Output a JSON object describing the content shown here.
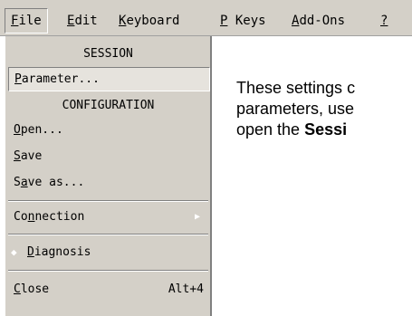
{
  "menubar": {
    "items": [
      {
        "pre": "",
        "u": "F",
        "post": "ile"
      },
      {
        "pre": "",
        "u": "E",
        "post": "dit"
      },
      {
        "pre": "",
        "u": "K",
        "post": "eyboard"
      },
      {
        "pre": "",
        "u": "P",
        "post": " Keys"
      },
      {
        "pre": "",
        "u": "A",
        "post": "dd-Ons"
      },
      {
        "pre": "",
        "u": "?",
        "post": ""
      }
    ]
  },
  "file_menu": {
    "session_heading": "SESSION",
    "parameter": {
      "u": "P",
      "post": "arameter..."
    },
    "config_heading": "CONFIGURATION",
    "open": {
      "u": "O",
      "post": "pen..."
    },
    "save": {
      "u": "S",
      "post": "ave"
    },
    "save_as": {
      "pre": "S",
      "u": "a",
      "post": "ve as..."
    },
    "connection": {
      "pre": "Co",
      "u": "n",
      "post": "nection"
    },
    "diagnosis": {
      "u": "D",
      "post": "iagnosis"
    },
    "close": {
      "u": "C",
      "post": "lose",
      "shortcut": "Alt+4"
    },
    "submenu_arrow": "▶",
    "check_mark": "◆"
  },
  "content": {
    "line1": "These settings c",
    "line2": "parameters, use",
    "line3_pre": "open the ",
    "line3_bold": "Sessi"
  }
}
